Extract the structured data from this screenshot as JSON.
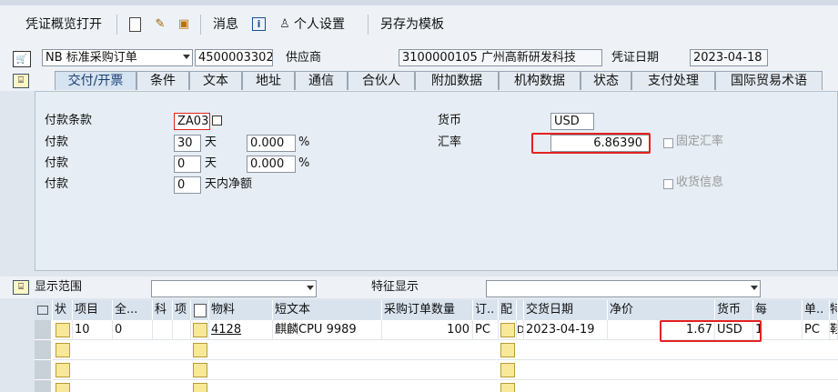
{
  "toolbar": {
    "overview_label": "凭证概览打开",
    "messages_label": "消息",
    "personal_settings_label": "个人设置",
    "save_as_template_label": "另存为模板"
  },
  "header": {
    "order_type": "NB 标准采购订单",
    "po_number": "4500003302",
    "vendor_label": "供应商",
    "vendor_value": "3100000105 广州高新研发科技",
    "doc_date_label": "凭证日期",
    "doc_date_value": "2023-04-18"
  },
  "tabs": [
    {
      "label": "交付/开票"
    },
    {
      "label": "条件"
    },
    {
      "label": "文本"
    },
    {
      "label": "地址"
    },
    {
      "label": "通信"
    },
    {
      "label": "合伙人"
    },
    {
      "label": "附加数据"
    },
    {
      "label": "机构数据"
    },
    {
      "label": "状态"
    },
    {
      "label": "支付处理"
    },
    {
      "label": "国际贸易术语"
    }
  ],
  "payment": {
    "terms_label": "付款条款",
    "terms_value": "ZA03",
    "rows": [
      {
        "label": "付款",
        "days": "30",
        "unit": "天",
        "pct": "0.000",
        "pct_sign": "%"
      },
      {
        "label": "付款",
        "days": "0",
        "unit": "天",
        "pct": "0.000",
        "pct_sign": "%"
      },
      {
        "label": "付款",
        "days": "0",
        "unit": "天内净额"
      }
    ]
  },
  "currency": {
    "currency_label": "货币",
    "currency_value": "USD",
    "rate_label": "汇率",
    "rate_value": "6.86390",
    "fixed_rate_label": "固定汇率",
    "gr_message_label": "收货信息"
  },
  "items_section": {
    "display_range_label": "显示范围",
    "feature_display_label": "特征显示"
  },
  "table": {
    "headers": [
      "状",
      "项目",
      "全...",
      "科",
      "项",
      "物料",
      "短文本",
      "采购订单数量",
      "订..",
      "配",
      "交货日期",
      "净价",
      "货币",
      "每",
      "单..",
      "特"
    ],
    "rows": [
      {
        "item": "10",
        "full": "0",
        "material": "4128",
        "short_text": "麒麟CPU 9989",
        "qty": "100",
        "unit": "PC",
        "cat": "D",
        "delivery_date": "2023-04-19",
        "net_price": "1.67",
        "currency": "USD",
        "per": "1",
        "order_unit": "PC",
        "extra": "鞋"
      }
    ]
  },
  "colors": {
    "highlight_red": "#e3221f",
    "tab_active_text": "#1a3e75"
  }
}
